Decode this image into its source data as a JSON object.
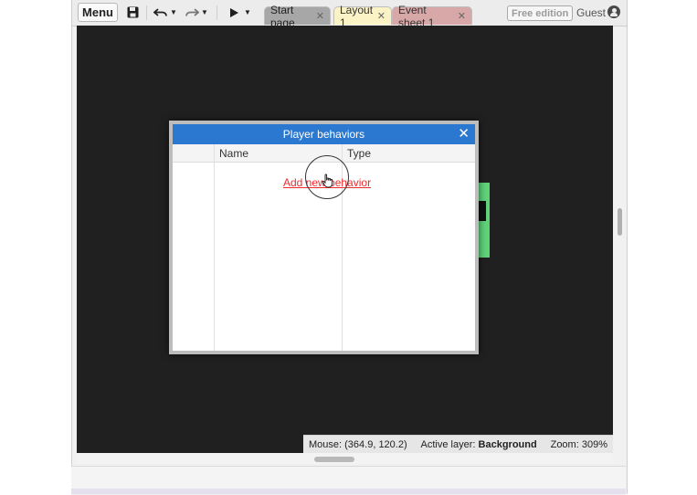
{
  "toolbar": {
    "menu_label": "Menu",
    "icons": [
      "save-icon",
      "undo-icon",
      "redo-icon",
      "play-icon"
    ],
    "tabs": [
      {
        "label": "Start page",
        "close": "✕"
      },
      {
        "label": "Layout 1",
        "close": "✕"
      },
      {
        "label": "Event sheet 1",
        "close": "✕"
      }
    ],
    "edition_badge": "Free edition",
    "user": "Guest"
  },
  "dialog": {
    "title": "Player behaviors",
    "close": "✕",
    "columns": [
      "Name",
      "Type"
    ],
    "add_link": "Add new behavior"
  },
  "statusbar": {
    "mouse_label": "Mouse:",
    "mouse_value": "(364.9, 120.2)",
    "layer_label": "Active layer:",
    "layer_value": "Background",
    "zoom_label": "Zoom:",
    "zoom_value": "309%"
  },
  "colors": {
    "titlebar": "#2b78d0",
    "link": "#ef2c2c",
    "canvas": "#202020",
    "sprite": "#5fd27a"
  }
}
